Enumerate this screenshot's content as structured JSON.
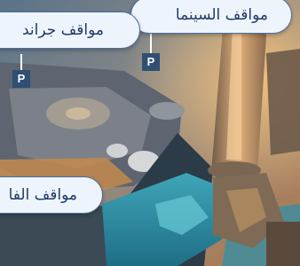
{
  "labels": {
    "cinema": "مواقف السينما",
    "grand": "مواقف جراند",
    "fashion": "مواقف الفا"
  },
  "markers": {
    "parking_1": "P",
    "parking_2": "P"
  },
  "colors": {
    "callout_bg": "#eef4fb",
    "callout_border": "#4a6fa0",
    "callout_text": "#1f3a6a",
    "marker_bg": "#2f4f73"
  }
}
